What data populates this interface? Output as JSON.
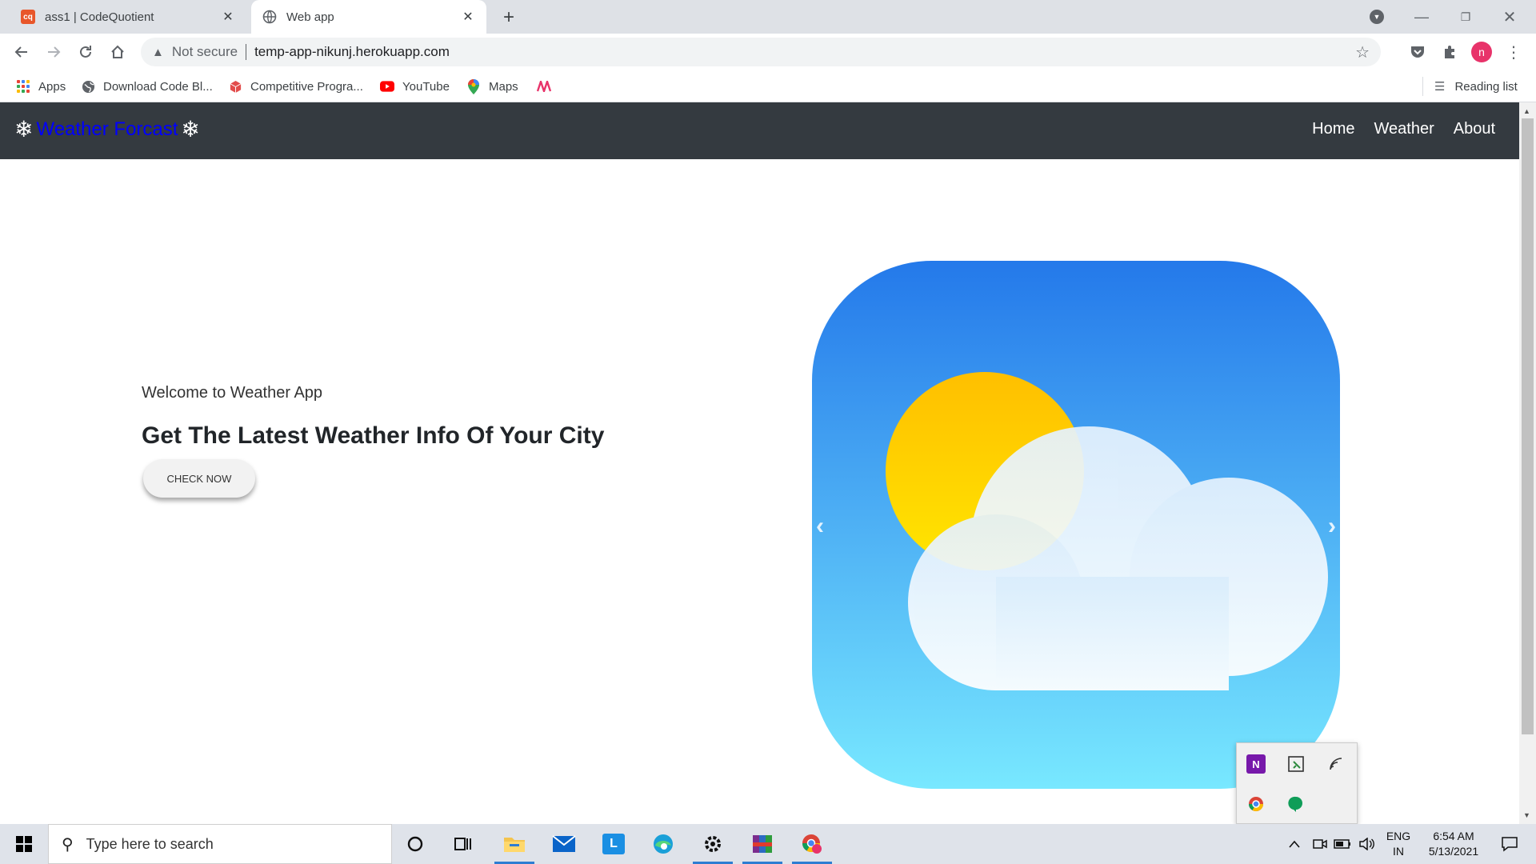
{
  "browser": {
    "tabs": [
      {
        "label": "ass1 | CodeQuotient",
        "favicon": "cq",
        "active": false
      },
      {
        "label": "Web app",
        "active": true
      }
    ],
    "address": {
      "security_label": "Not secure",
      "url": "temp-app-nikunj.herokuapp.com"
    },
    "profile_initial": "n",
    "bookmarks": [
      {
        "label": "Apps",
        "icon": "apps-grid-icon"
      },
      {
        "label": "Download Code Bl...",
        "icon": "globe-icon"
      },
      {
        "label": "Competitive Progra...",
        "icon": "cube-icon"
      },
      {
        "label": "YouTube",
        "icon": "youtube-icon"
      },
      {
        "label": "Maps",
        "icon": "maps-pin-icon"
      },
      {
        "label": "",
        "icon": "m-logo-icon"
      }
    ],
    "reading_list_label": "Reading list"
  },
  "site": {
    "brand": {
      "icon": "❄",
      "name": "Weather Forcast"
    },
    "nav": [
      "Home",
      "Weather",
      "About"
    ],
    "hero": {
      "welcome": "Welcome to Weather App",
      "title": "Get The Latest Weather Info Of Your City",
      "button": "CHECK NOW"
    },
    "colors": {
      "navbar": "#343a40",
      "brand_text": "#0000ff",
      "icon_top": "#2479ea",
      "icon_bottom": "#78e8ff",
      "sun": "#ffc800"
    }
  },
  "taskbar": {
    "search_placeholder": "Type here to search",
    "language": [
      "ENG",
      "IN"
    ],
    "time": "6:54 AM",
    "date": "5/13/2021"
  }
}
